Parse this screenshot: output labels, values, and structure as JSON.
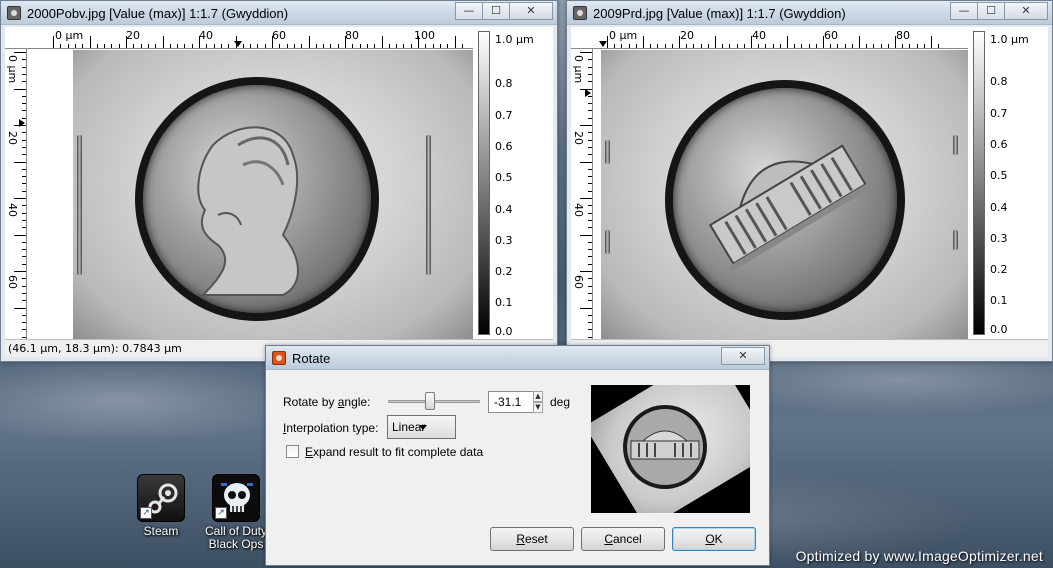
{
  "desktop": {
    "icons": [
      {
        "label": "Steam",
        "icon": "steam-icon"
      },
      {
        "label": "Call of Duty Black Ops",
        "icon": "black-ops-skull-icon"
      }
    ],
    "watermark": "Optimized by www.ImageOptimizer.net"
  },
  "window1": {
    "title": "2000Pobv.jpg [Value (max)] 1:1.7 (Gwyddion)",
    "hruler_labels": [
      "0 µm",
      "20",
      "40",
      "60",
      "80",
      "100"
    ],
    "vruler_labels": [
      "0 µm",
      "20",
      "40",
      "60"
    ],
    "colorbar_labels": [
      "1.0 µm",
      "0.8",
      "0.7",
      "0.6",
      "0.5",
      "0.4",
      "0.3",
      "0.2",
      "0.1",
      "0.0"
    ],
    "status": "(46.1 µm, 18.3 µm): 0.7843 µm"
  },
  "window2": {
    "title": "2009Prd.jpg [Value (max)] 1:1.7 (Gwyddion)",
    "hruler_labels": [
      "0 µm",
      "20",
      "40",
      "60",
      "80"
    ],
    "vruler_labels": [
      "0 µm",
      "20",
      "40",
      "60"
    ],
    "colorbar_labels": [
      "1.0 µm",
      "0.8",
      "0.7",
      "0.6",
      "0.5",
      "0.4",
      "0.3",
      "0.2",
      "0.1",
      "0.0"
    ]
  },
  "window_controls": {
    "minimize": "—",
    "maximize": "☐",
    "close": "✕"
  },
  "rotate_dialog": {
    "title": "Rotate",
    "angle_label_pre": "Rotate by ",
    "angle_label_u": "a",
    "angle_label_post": "ngle:",
    "angle_value": "-31.1",
    "angle_unit": "deg",
    "interp_label_pre": "",
    "interp_label_u": "I",
    "interp_label_post": "nterpolation type:",
    "interp_value": "Linear",
    "expand_label_pre": "",
    "expand_label_u": "E",
    "expand_label_post": "xpand result to fit complete data",
    "expand_checked": false,
    "reset_u": "R",
    "reset_rest": "eset",
    "cancel_u": "C",
    "cancel_rest": "ancel",
    "ok_u": "O",
    "ok_rest": "K"
  }
}
